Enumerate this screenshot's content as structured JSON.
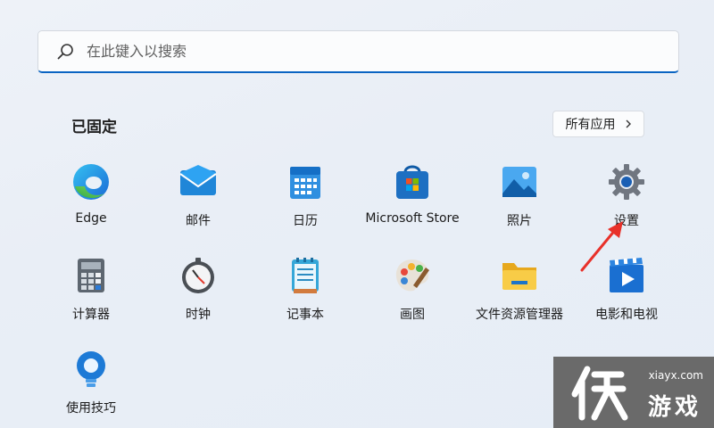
{
  "search": {
    "placeholder": "在此键入以搜索"
  },
  "pinned": {
    "title": "已固定",
    "all_apps_label": "所有应用",
    "apps": [
      {
        "label": "Edge"
      },
      {
        "label": "邮件"
      },
      {
        "label": "日历"
      },
      {
        "label": "Microsoft Store"
      },
      {
        "label": "照片"
      },
      {
        "label": "设置"
      },
      {
        "label": "计算器"
      },
      {
        "label": "时钟"
      },
      {
        "label": "记事本"
      },
      {
        "label": "画图"
      },
      {
        "label": "文件资源管理器"
      },
      {
        "label": "电影和电视"
      },
      {
        "label": "使用技巧"
      }
    ]
  },
  "watermark": {
    "site": "xiayx.com",
    "brand": "游戏"
  },
  "colors": {
    "accent": "#0a64c2",
    "arrow": "#e8312a"
  }
}
